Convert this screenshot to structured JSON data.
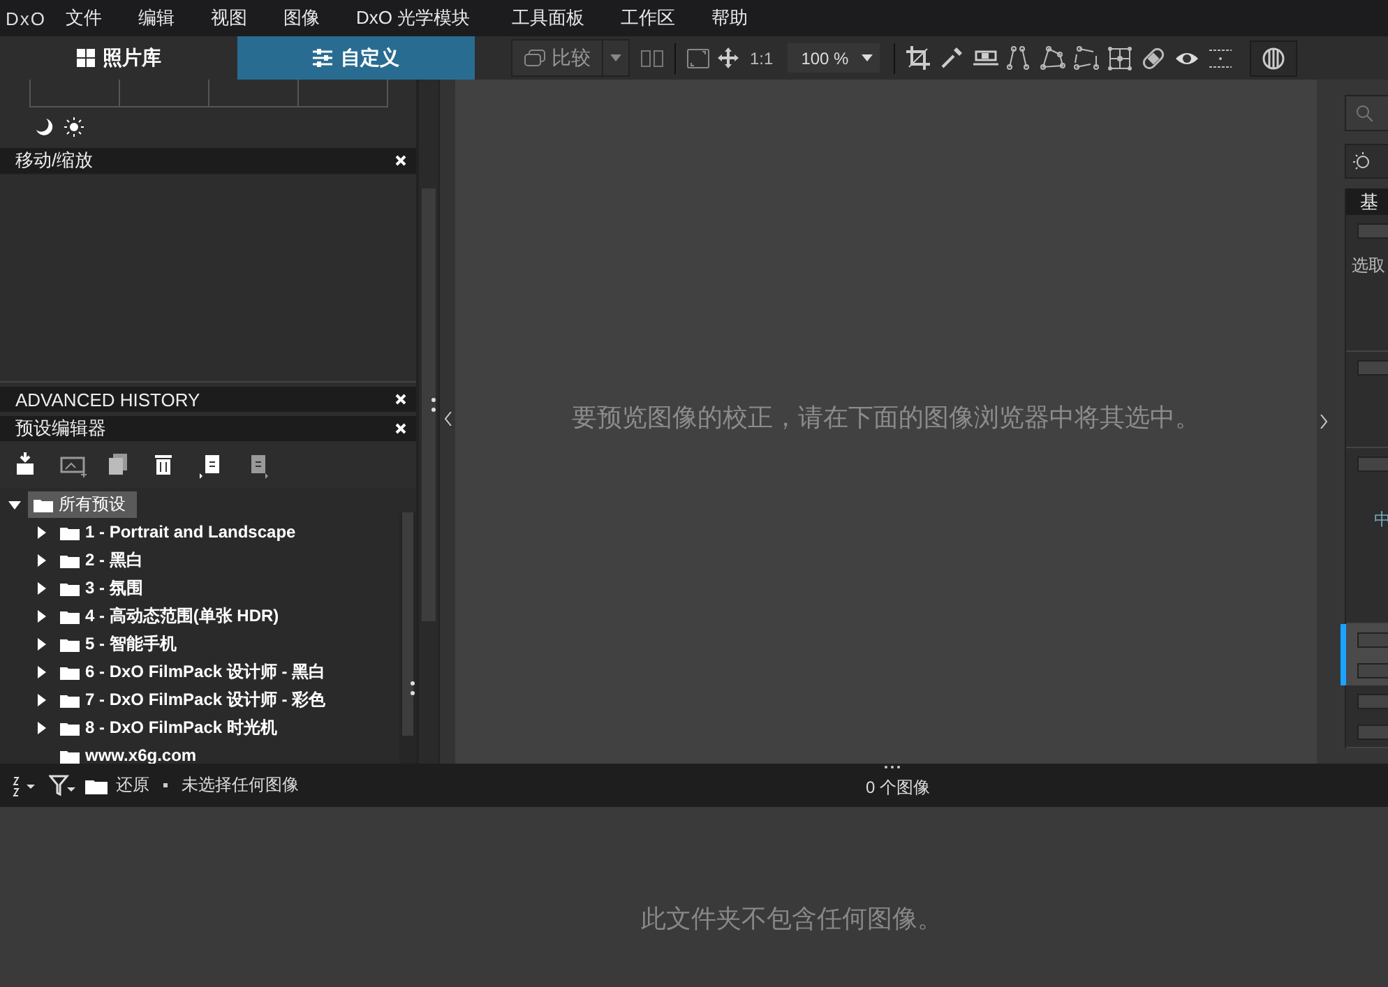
{
  "menu": {
    "logo": "DxO",
    "items": [
      "文件",
      "编辑",
      "视图",
      "图像",
      "DxO 光学模块",
      "工具面板",
      "工作区",
      "帮助"
    ]
  },
  "modes": [
    {
      "label": "照片库",
      "selected": false
    },
    {
      "label": "自定义",
      "selected": true
    }
  ],
  "toolbar": {
    "compare": "比较",
    "ratio": "1:1",
    "zoom": "100 %"
  },
  "panels": {
    "move_zoom": {
      "title": "移动/缩放"
    },
    "history": {
      "title": "ADVANCED HISTORY"
    },
    "presets": {
      "title": "预设编辑器",
      "tree": {
        "label": "所有预设",
        "expanded": true,
        "selected": true,
        "children": [
          {
            "label": "1 - Portrait and Landscape",
            "expanded": false
          },
          {
            "label": "2 - 黑白",
            "expanded": false
          },
          {
            "label": "3 - 氛围",
            "expanded": false
          },
          {
            "label": "4 - 高动态范围(单张 HDR)",
            "expanded": false
          },
          {
            "label": "5 - 智能手机",
            "expanded": false
          },
          {
            "label": "6 - DxO FilmPack 设计师 - 黑白",
            "expanded": false
          },
          {
            "label": "7 - DxO FilmPack 设计师 - 彩色",
            "expanded": false
          },
          {
            "label": "8 - DxO FilmPack 时光机",
            "expanded": false
          },
          {
            "label": "www.x6g.com"
          }
        ]
      }
    }
  },
  "viewer": {
    "message": "要预览图像的校正，请在下面的图像浏览器中将其选中。"
  },
  "right_panel": {
    "title": "基",
    "sections": [
      {
        "label": "选取",
        "toggles": [
          {
            "active": false
          }
        ]
      },
      {
        "toggles": [
          {
            "active": false
          }
        ]
      },
      {
        "label": "中",
        "toggles": [
          {
            "active": false
          }
        ]
      },
      {
        "toggles": [
          {
            "active": true
          },
          {
            "active": true
          },
          {
            "active": false
          },
          {
            "active": false
          }
        ]
      }
    ]
  },
  "browser_bar": {
    "action": "还原",
    "status": "未选择任何图像",
    "count": "0 个图像"
  },
  "filmstrip": {
    "message": "此文件夹不包含任何图像。"
  }
}
